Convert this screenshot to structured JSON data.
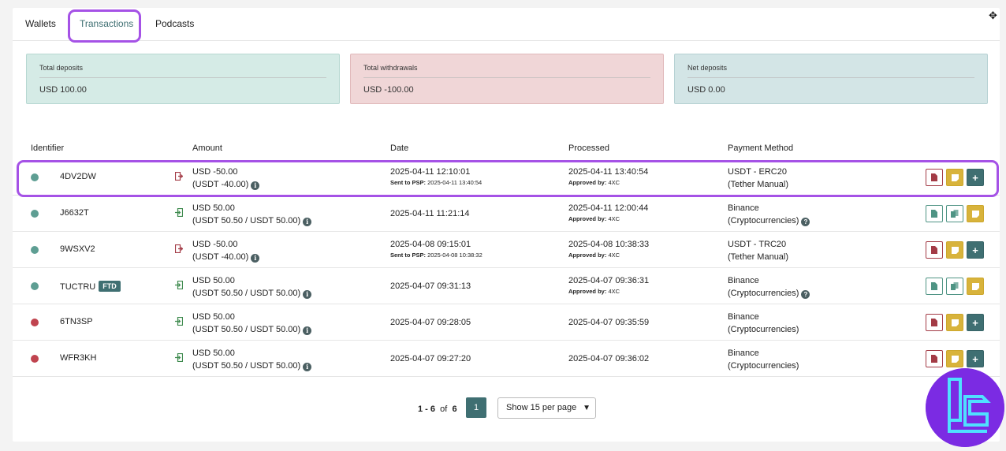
{
  "tabs": [
    {
      "label": "Wallets"
    },
    {
      "label": "Transactions"
    },
    {
      "label": "Podcasts"
    }
  ],
  "summary": {
    "deposits": {
      "label": "Total deposits",
      "value": "USD 100.00"
    },
    "withdrawals": {
      "label": "Total withdrawals",
      "value": "USD -100.00"
    },
    "net": {
      "label": "Net deposits",
      "value": "USD 0.00"
    }
  },
  "columns": [
    "Identifier",
    "Amount",
    "Date",
    "Processed",
    "Payment Method"
  ],
  "sub_labels": {
    "sent": "Sent to PSP:",
    "approved": "Approved by:"
  },
  "rows": [
    {
      "status": "green",
      "id": "4DV2DW",
      "amount": "USD -50.00",
      "amount_sub": "(USDT -40.00)",
      "date": "2025-04-11 12:10:01",
      "sent": "2025-04-11 13:40:54",
      "processed": "2025-04-11 13:40:54",
      "approved": "4XC",
      "pm1": "USDT - ERC20",
      "pm2": "(Tether Manual)"
    },
    {
      "status": "green",
      "id": "J6632T",
      "amount": "USD 50.00",
      "amount_sub": "(USDT 50.50 / USDT 50.00)",
      "date": "2025-04-11 11:21:14",
      "processed": "2025-04-11 12:00:44",
      "approved": "4XC",
      "pm1": "Binance",
      "pm2": "(Cryptocurrencies)"
    },
    {
      "status": "green",
      "id": "9WSXV2",
      "amount": "USD -50.00",
      "amount_sub": "(USDT -40.00)",
      "date": "2025-04-08 09:15:01",
      "sent": "2025-04-08 10:38:32",
      "processed": "2025-04-08 10:38:33",
      "approved": "4XC",
      "pm1": "USDT - TRC20",
      "pm2": "(Tether Manual)"
    },
    {
      "status": "green",
      "id": "TUCTRU",
      "badge": "FTD",
      "amount": "USD 50.00",
      "amount_sub": "(USDT 50.50 / USDT 50.00)",
      "date": "2025-04-07 09:31:13",
      "processed": "2025-04-07 09:36:31",
      "approved": "4XC",
      "pm1": "Binance",
      "pm2": "(Cryptocurrencies)"
    },
    {
      "status": "red",
      "id": "6TN3SP",
      "amount": "USD 50.00",
      "amount_sub": "(USDT 50.50 / USDT 50.00)",
      "date": "2025-04-07 09:28:05",
      "processed": "2025-04-07 09:35:59",
      "pm1": "Binance",
      "pm2": "(Cryptocurrencies)"
    },
    {
      "status": "red",
      "id": "WFR3KH",
      "amount": "USD 50.00",
      "amount_sub": "(USDT 50.50 / USDT 50.00)",
      "date": "2025-04-07 09:27:20",
      "processed": "2025-04-07 09:36:02",
      "pm1": "Binance",
      "pm2": "(Cryptocurrencies)"
    }
  ],
  "pagination": {
    "range": "1 - 6",
    "of": "of",
    "total": "6",
    "page": "1",
    "per_page": "Show 15 per page"
  },
  "colors": {
    "accent": "#3f6f72",
    "highlight": "#a552e6",
    "green_dot": "#5e9e93",
    "red_dot": "#c0444f"
  }
}
